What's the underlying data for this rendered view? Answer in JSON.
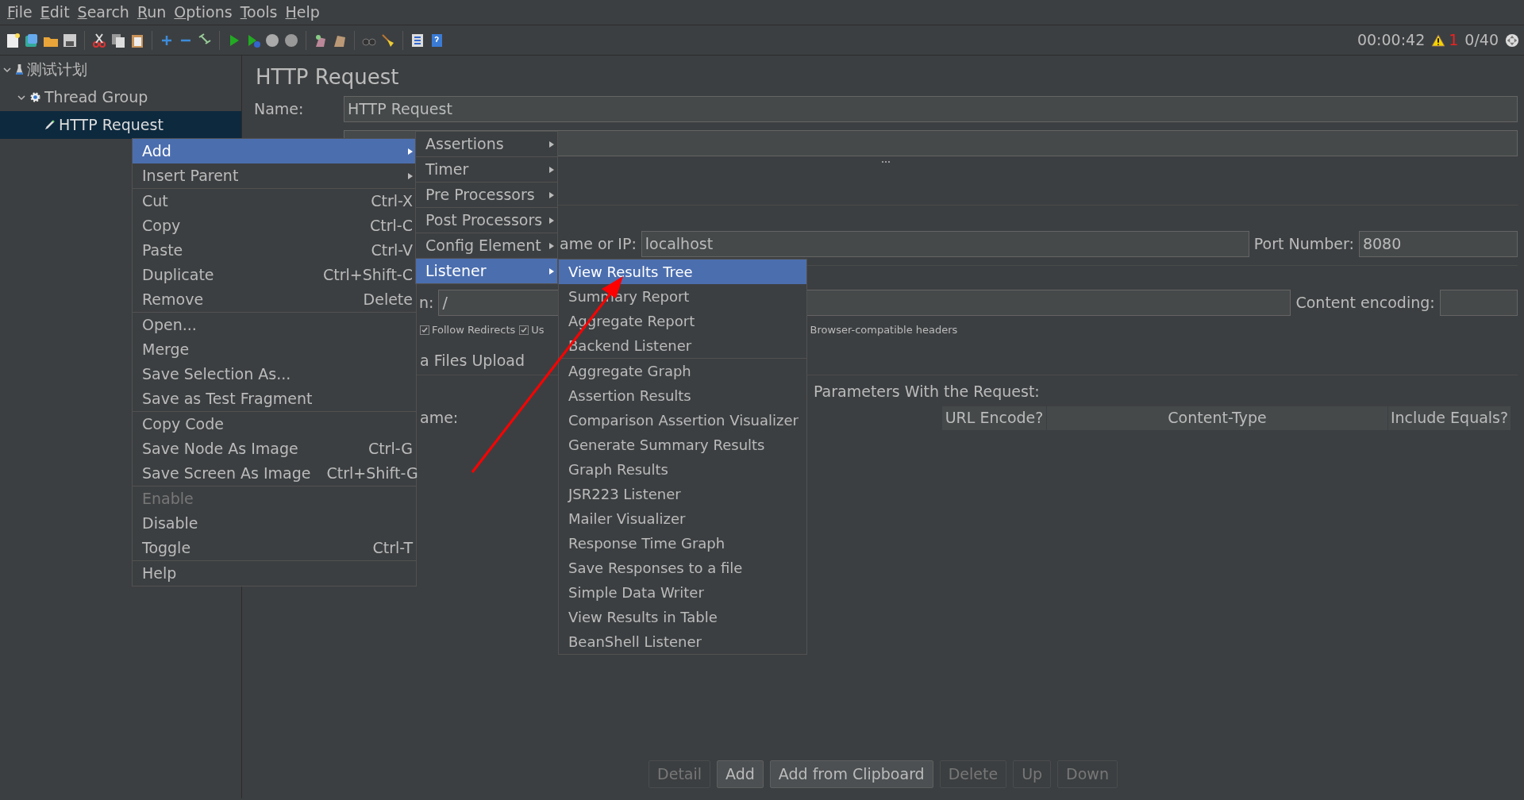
{
  "menubar": [
    "File",
    "Edit",
    "Search",
    "Run",
    "Options",
    "Tools",
    "Help"
  ],
  "status": {
    "timer": "00:00:42",
    "warnings": "1",
    "threads": "0/40"
  },
  "tree": [
    {
      "label": "测试计划",
      "expanded": true,
      "selected": false,
      "children": [
        {
          "label": "Thread Group",
          "expanded": true,
          "selected": false,
          "children": [
            {
              "label": "HTTP Request",
              "selected": true
            }
          ]
        }
      ]
    }
  ],
  "editor": {
    "title": "HTTP Request",
    "name_label": "Name:",
    "name_value": "HTTP Request",
    "server_label": "ame or IP:",
    "server_value": "localhost",
    "port_label": "Port Number:",
    "port_value": "8080",
    "path_label": "n:",
    "path_value": "/",
    "encoding_label": "Content encoding:",
    "checkboxes": [
      {
        "label": "Follow Redirects",
        "checked": true
      },
      {
        "label": "Us",
        "checked": true
      }
    ],
    "browser_headers": "Browser-compatible headers",
    "files_upload": "a Files Upload",
    "params_title": "Parameters With the Request:",
    "columns": [
      "ame:",
      "URL Encode?",
      "Content-Type",
      "Include Equals?"
    ],
    "buttons": [
      {
        "label": "Detail",
        "disabled": true
      },
      {
        "label": "Add",
        "disabled": false
      },
      {
        "label": "Add from Clipboard",
        "disabled": false
      },
      {
        "label": "Delete",
        "disabled": true
      },
      {
        "label": "Up",
        "disabled": true
      },
      {
        "label": "Down",
        "disabled": true
      }
    ]
  },
  "context_menu": [
    [
      {
        "label": "Add",
        "submenu": true,
        "selected": true,
        "disabled": false
      },
      {
        "label": "Insert Parent",
        "submenu": true,
        "selected": false,
        "disabled": false
      }
    ],
    [
      {
        "label": "Cut",
        "shortcut": "Ctrl-X",
        "selected": false,
        "disabled": false
      },
      {
        "label": "Copy",
        "shortcut": "Ctrl-C",
        "selected": false,
        "disabled": false
      },
      {
        "label": "Paste",
        "shortcut": "Ctrl-V",
        "selected": false,
        "disabled": false
      },
      {
        "label": "Duplicate",
        "shortcut": "Ctrl+Shift-C",
        "selected": false,
        "disabled": false
      },
      {
        "label": "Remove",
        "shortcut": "Delete",
        "selected": false,
        "disabled": false
      }
    ],
    [
      {
        "label": "Open...",
        "selected": false,
        "disabled": false
      },
      {
        "label": "Merge",
        "selected": false,
        "disabled": false
      },
      {
        "label": "Save Selection As...",
        "selected": false,
        "disabled": false
      },
      {
        "label": "Save as Test Fragment",
        "selected": false,
        "disabled": false
      }
    ],
    [
      {
        "label": "Copy Code",
        "selected": false,
        "disabled": false
      },
      {
        "label": "Save Node As Image",
        "shortcut": "Ctrl-G",
        "selected": false,
        "disabled": false
      },
      {
        "label": "Save Screen As Image",
        "shortcut": "Ctrl+Shift-G",
        "selected": false,
        "disabled": false
      }
    ],
    [
      {
        "label": "Enable",
        "selected": false,
        "disabled": true
      },
      {
        "label": "Disable",
        "selected": false,
        "disabled": false
      },
      {
        "label": "Toggle",
        "shortcut": "Ctrl-T",
        "selected": false,
        "disabled": false
      }
    ],
    [
      {
        "label": "Help",
        "selected": false,
        "disabled": false
      }
    ]
  ],
  "add_submenu": [
    [
      {
        "label": "Assertions",
        "submenu": true,
        "selected": false
      }
    ],
    [
      {
        "label": "Timer",
        "submenu": true,
        "selected": false
      }
    ],
    [
      {
        "label": "Pre Processors",
        "submenu": true,
        "selected": false
      }
    ],
    [
      {
        "label": "Post Processors",
        "submenu": true,
        "selected": false
      }
    ],
    [
      {
        "label": "Config Element",
        "submenu": true,
        "selected": false
      }
    ],
    [
      {
        "label": "Listener",
        "submenu": true,
        "selected": true
      }
    ]
  ],
  "listener_submenu": [
    [
      {
        "label": "View Results Tree",
        "selected": true
      },
      {
        "label": "Summary Report",
        "selected": false
      },
      {
        "label": "Aggregate Report",
        "selected": false
      },
      {
        "label": "Backend Listener",
        "selected": false
      }
    ],
    [
      {
        "label": "Aggregate Graph",
        "selected": false
      },
      {
        "label": "Assertion Results",
        "selected": false
      },
      {
        "label": "Comparison Assertion Visualizer",
        "selected": false
      },
      {
        "label": "Generate Summary Results",
        "selected": false
      },
      {
        "label": "Graph Results",
        "selected": false
      },
      {
        "label": "JSR223 Listener",
        "selected": false
      },
      {
        "label": "Mailer Visualizer",
        "selected": false
      },
      {
        "label": "Response Time Graph",
        "selected": false
      },
      {
        "label": "Save Responses to a file",
        "selected": false
      },
      {
        "label": "Simple Data Writer",
        "selected": false
      },
      {
        "label": "View Results in Table",
        "selected": false
      },
      {
        "label": "BeanShell Listener",
        "selected": false
      }
    ]
  ]
}
